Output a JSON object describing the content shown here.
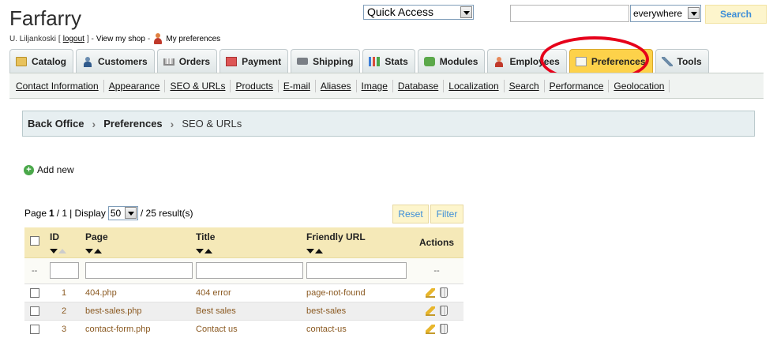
{
  "header": {
    "shop_name": "Farfarry",
    "user_name": "U. Liljankoski",
    "logout_label": "logout",
    "view_shop_label": "View my shop",
    "my_preferences_label": "My preferences",
    "quick_access_label": "Quick Access",
    "search_value": "",
    "search_scope": "everywhere",
    "search_button_label": "Search"
  },
  "tabs": [
    {
      "label": "Catalog",
      "icon": "catalog-icon"
    },
    {
      "label": "Customers",
      "icon": "customers-icon"
    },
    {
      "label": "Orders",
      "icon": "orders-icon"
    },
    {
      "label": "Payment",
      "icon": "payment-icon"
    },
    {
      "label": "Shipping",
      "icon": "shipping-icon"
    },
    {
      "label": "Stats",
      "icon": "stats-icon"
    },
    {
      "label": "Modules",
      "icon": "modules-icon"
    },
    {
      "label": "Employees",
      "icon": "employees-icon"
    },
    {
      "label": "Preferences",
      "icon": "preferences-icon",
      "active": true
    },
    {
      "label": "Tools",
      "icon": "tools-icon"
    }
  ],
  "subnav": [
    "Contact Information",
    "Appearance",
    "SEO & URLs",
    "Products",
    "E-mail",
    "Aliases",
    "Image",
    "Database",
    "Localization",
    "Search",
    "Performance",
    "Geolocation"
  ],
  "breadcrumb": {
    "root": "Back Office",
    "section": "Preferences",
    "current": "SEO & URLs"
  },
  "add_new_label": "Add new",
  "pager": {
    "page_label": "Page",
    "page_current": "1",
    "page_total": "/ 1",
    "display_label": "| Display",
    "per_page": "50",
    "results_text": "/ 25 result(s)"
  },
  "buttons": {
    "reset": "Reset",
    "filter": "Filter"
  },
  "table": {
    "columns": {
      "id": "ID",
      "page": "Page",
      "title": "Title",
      "friendly_url": "Friendly URL",
      "actions": "Actions"
    },
    "filter_placeholder": "--",
    "rows": [
      {
        "id": "1",
        "page": "404.php",
        "title": "404 error",
        "friendly_url": "page-not-found"
      },
      {
        "id": "2",
        "page": "best-sales.php",
        "title": "Best sales",
        "friendly_url": "best-sales"
      },
      {
        "id": "3",
        "page": "contact-form.php",
        "title": "Contact us",
        "friendly_url": "contact-us"
      }
    ]
  },
  "colors": {
    "active_tab": "#fdd24a",
    "annotation_circle": "#e6001a",
    "button_text": "#3d8ed8",
    "row_text": "#8b5a22"
  }
}
